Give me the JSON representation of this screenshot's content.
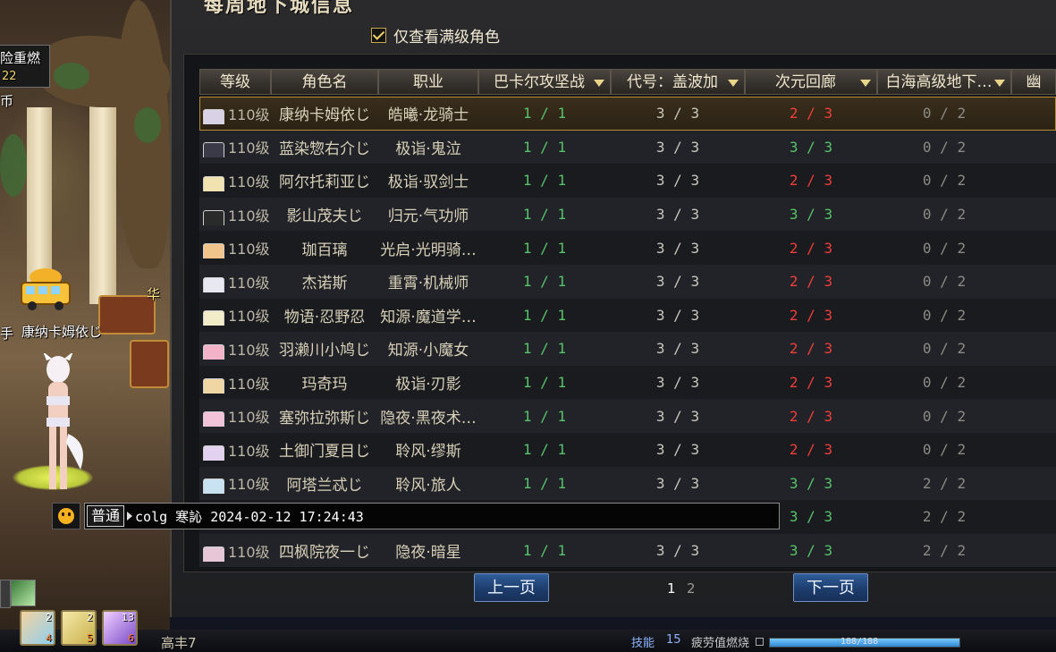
{
  "window": {
    "title": "每周地下城信息"
  },
  "filter": {
    "label": "仅查看满级角色",
    "checked": true
  },
  "table": {
    "headers": [
      {
        "label": "等级",
        "sortable": false
      },
      {
        "label": "角色名",
        "sortable": false
      },
      {
        "label": "职业",
        "sortable": false
      },
      {
        "label": "巴卡尔攻坚战",
        "sortable": true
      },
      {
        "label": "代号：盖波加",
        "sortable": true
      },
      {
        "label": "次元回廊",
        "sortable": true
      },
      {
        "label": "白海高级地下…",
        "sortable": true
      },
      {
        "label": "幽",
        "sortable": false
      }
    ],
    "rows": [
      {
        "level": "110级",
        "name": "康纳卡姆依じ",
        "job": "皓曦·龙骑士",
        "d1": "1 / 1",
        "d2": "3 / 3",
        "d3": "2 / 3",
        "d3_status": "red",
        "d4": "0 / 2",
        "selected": true,
        "avatar_color": "#d9d2e6"
      },
      {
        "level": "110级",
        "name": "蓝染惣右介じ",
        "job": "极诣·鬼泣",
        "d1": "1 / 1",
        "d2": "3 / 3",
        "d3": "3 / 3",
        "d3_status": "green",
        "d4": "0 / 2",
        "selected": false,
        "avatar_color": "#3a3a48"
      },
      {
        "level": "110级",
        "name": "阿尔托莉亚じ",
        "job": "极诣·驭剑士",
        "d1": "1 / 1",
        "d2": "3 / 3",
        "d3": "2 / 3",
        "d3_status": "red",
        "d4": "0 / 2",
        "selected": false,
        "avatar_color": "#f1e3b0"
      },
      {
        "level": "110级",
        "name": "影山茂夫じ",
        "job": "归元·气功师",
        "d1": "1 / 1",
        "d2": "3 / 3",
        "d3": "3 / 3",
        "d3_status": "green",
        "d4": "0 / 2",
        "selected": false,
        "avatar_color": "#2a2a2a"
      },
      {
        "level": "110级",
        "name": "珈百璃",
        "job": "光启·光明骑…",
        "d1": "1 / 1",
        "d2": "3 / 3",
        "d3": "2 / 3",
        "d3_status": "red",
        "d4": "0 / 2",
        "selected": false,
        "avatar_color": "#f0c48a"
      },
      {
        "level": "110级",
        "name": "杰诺斯",
        "job": "重霄·机械师",
        "d1": "1 / 1",
        "d2": "3 / 3",
        "d3": "2 / 3",
        "d3_status": "red",
        "d4": "0 / 2",
        "selected": false,
        "avatar_color": "#e8e8f2"
      },
      {
        "level": "110级",
        "name": "物语·忍野忍",
        "job": "知源·魔道学…",
        "d1": "1 / 1",
        "d2": "3 / 3",
        "d3": "2 / 3",
        "d3_status": "red",
        "d4": "0 / 2",
        "selected": false,
        "avatar_color": "#f3ecc9"
      },
      {
        "level": "110级",
        "name": "羽濑川小鸠じ",
        "job": "知源·小魔女",
        "d1": "1 / 1",
        "d2": "3 / 3",
        "d3": "2 / 3",
        "d3_status": "red",
        "d4": "0 / 2",
        "selected": false,
        "avatar_color": "#f2b3c8"
      },
      {
        "level": "110级",
        "name": "玛奇玛",
        "job": "极诣·刃影",
        "d1": "1 / 1",
        "d2": "3 / 3",
        "d3": "2 / 3",
        "d3_status": "red",
        "d4": "0 / 2",
        "selected": false,
        "avatar_color": "#efd6a2"
      },
      {
        "level": "110级",
        "name": "塞弥拉弥斯じ",
        "job": "隐夜·黑夜术…",
        "d1": "1 / 1",
        "d2": "3 / 3",
        "d3": "2 / 3",
        "d3_status": "red",
        "d4": "0 / 2",
        "selected": false,
        "avatar_color": "#f2c3d8"
      },
      {
        "level": "110级",
        "name": "土御门夏目じ",
        "job": "聆风·缪斯",
        "d1": "1 / 1",
        "d2": "3 / 3",
        "d3": "2 / 3",
        "d3_status": "red",
        "d4": "0 / 2",
        "selected": false,
        "avatar_color": "#e2d2f0"
      },
      {
        "level": "110级",
        "name": "阿塔兰忒じ",
        "job": "聆风·旅人",
        "d1": "1 / 1",
        "d2": "3 / 3",
        "d3": "3 / 3",
        "d3_status": "green",
        "d4": "2 / 2",
        "selected": false,
        "avatar_color": "#c9e2f2"
      },
      {
        "level": "",
        "name": "",
        "job": "",
        "d1": "",
        "d2": "",
        "d3": "3 / 3",
        "d3_status": "green",
        "d4": "2 / 2",
        "selected": false,
        "avatar_color": ""
      },
      {
        "level": "110级",
        "name": "四枫院夜一じ",
        "job": "隐夜·暗星",
        "d1": "1 / 1",
        "d2": "3 / 3",
        "d3": "3 / 3",
        "d3_status": "green",
        "d4": "2 / 2",
        "selected": false,
        "avatar_color": "#e7c6d8"
      }
    ]
  },
  "pagination": {
    "prev_label": "上一页",
    "next_label": "下一页",
    "pages": [
      "1",
      "2"
    ],
    "current": "1"
  },
  "chat": {
    "channel": "普通",
    "text": "colg 寒訫 2024-02-12 17:24:43"
  },
  "scene": {
    "player_name": "康纳卡姆依じ",
    "left_fragments": [
      "险重燃",
      "22",
      "币",
      "手"
    ],
    "other_tag": "华"
  },
  "hud": {
    "skill_slots": [
      {
        "count": "2",
        "key": "4",
        "color": "#e79a4a"
      },
      {
        "count": "2",
        "key": "5",
        "color": "#c7b04a"
      },
      {
        "count": "13",
        "key": "6",
        "color": "#7a4ac7"
      }
    ],
    "player_label": "高丰7",
    "skill_label": "技能",
    "skill_count": "15",
    "fatigue_label": "疲劳值燃烧",
    "fatigue_text": "188/188",
    "fatigue_fraction": 1.0
  },
  "colors": {
    "red": "#ef3e3a",
    "green": "#56c26a",
    "accent_gold": "#c9a64d",
    "button_blue": "#2f5d98"
  }
}
